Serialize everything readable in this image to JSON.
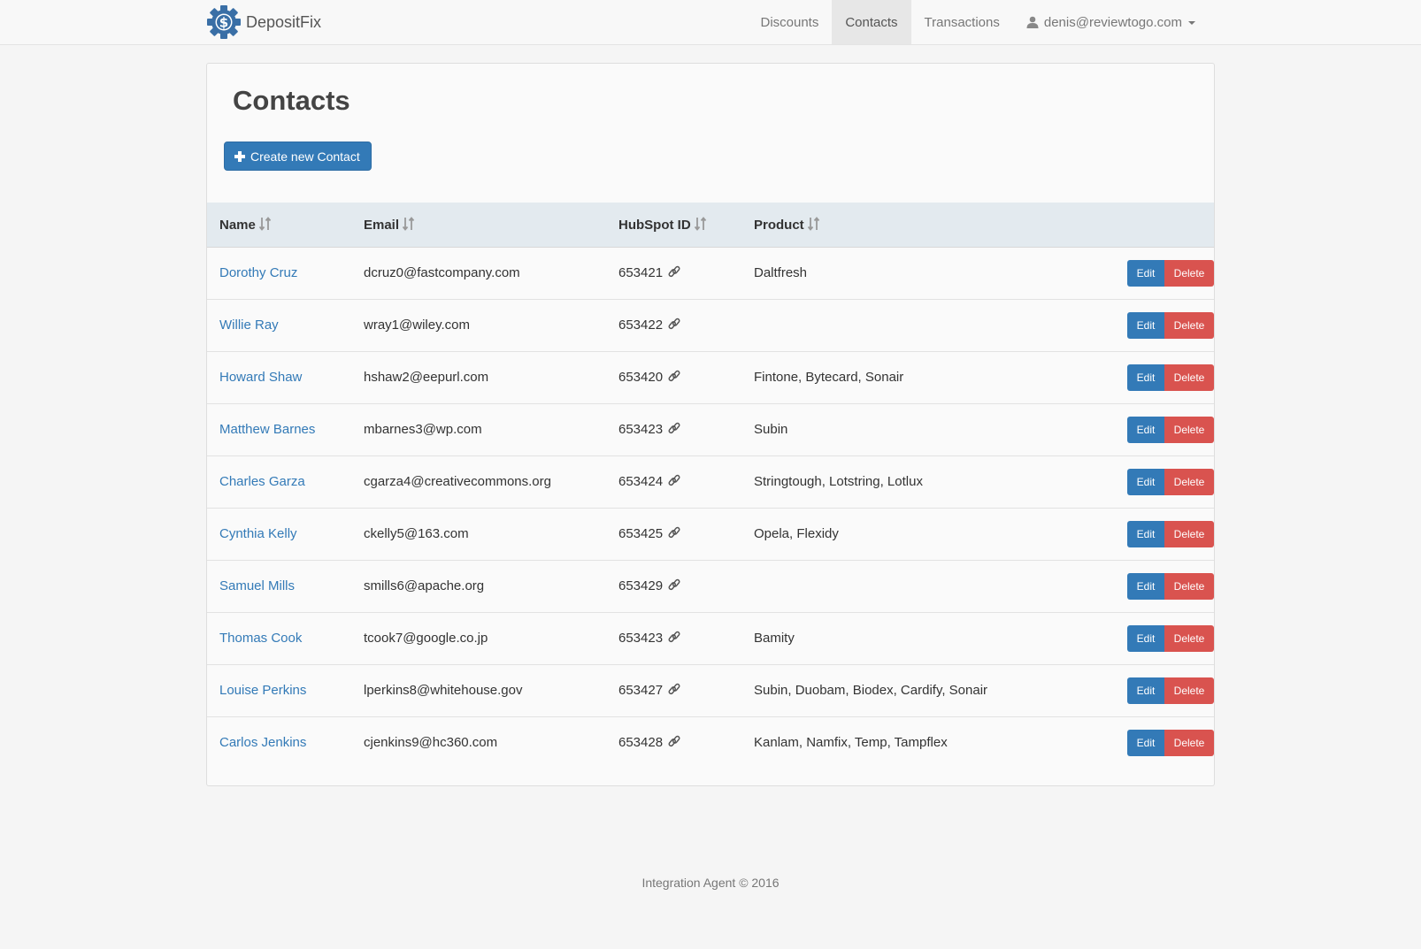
{
  "navbar": {
    "brand": "DepositFix",
    "items": [
      {
        "label": "Discounts",
        "active": false
      },
      {
        "label": "Contacts",
        "active": true
      },
      {
        "label": "Transactions",
        "active": false
      }
    ],
    "user_email": "denis@reviewtogo.com"
  },
  "page": {
    "title": "Contacts",
    "create_button": "Create new Contact"
  },
  "table": {
    "columns": [
      "Name",
      "Email",
      "HubSpot ID",
      "Product"
    ],
    "edit_label": "Edit",
    "delete_label": "Delete",
    "rows": [
      {
        "name": "Dorothy Cruz",
        "email": "dcruz0@fastcompany.com",
        "hubspot_id": "653421",
        "product": "Daltfresh"
      },
      {
        "name": "Willie Ray",
        "email": "wray1@wiley.com",
        "hubspot_id": "653422",
        "product": ""
      },
      {
        "name": "Howard Shaw",
        "email": "hshaw2@eepurl.com",
        "hubspot_id": "653420",
        "product": "Fintone, Bytecard, Sonair"
      },
      {
        "name": "Matthew Barnes",
        "email": "mbarnes3@wp.com",
        "hubspot_id": "653423",
        "product": "Subin"
      },
      {
        "name": "Charles Garza",
        "email": "cgarza4@creativecommons.org",
        "hubspot_id": "653424",
        "product": "Stringtough, Lotstring, Lotlux"
      },
      {
        "name": "Cynthia Kelly",
        "email": "ckelly5@163.com",
        "hubspot_id": "653425",
        "product": "Opela, Flexidy"
      },
      {
        "name": "Samuel Mills",
        "email": "smills6@apache.org",
        "hubspot_id": "653429",
        "product": ""
      },
      {
        "name": "Thomas Cook",
        "email": "tcook7@google.co.jp",
        "hubspot_id": "653423",
        "product": "Bamity"
      },
      {
        "name": "Louise Perkins",
        "email": "lperkins8@whitehouse.gov",
        "hubspot_id": "653427",
        "product": "Subin, Duobam, Biodex, Cardify, Sonair"
      },
      {
        "name": "Carlos Jenkins",
        "email": "cjenkins9@hc360.com",
        "hubspot_id": "653428",
        "product": "Kanlam, Namfix, Temp, Tampflex"
      }
    ]
  },
  "footer": {
    "text": "Integration Agent © 2016"
  },
  "icons": {
    "brand": "dollar-gear-icon",
    "user": "user-icon",
    "create": "plus-icon",
    "sort": "sort-icon",
    "link": "link-icon"
  },
  "colors": {
    "primary": "#337ab7",
    "danger": "#d9534f",
    "table_header": "#e3eaef"
  }
}
